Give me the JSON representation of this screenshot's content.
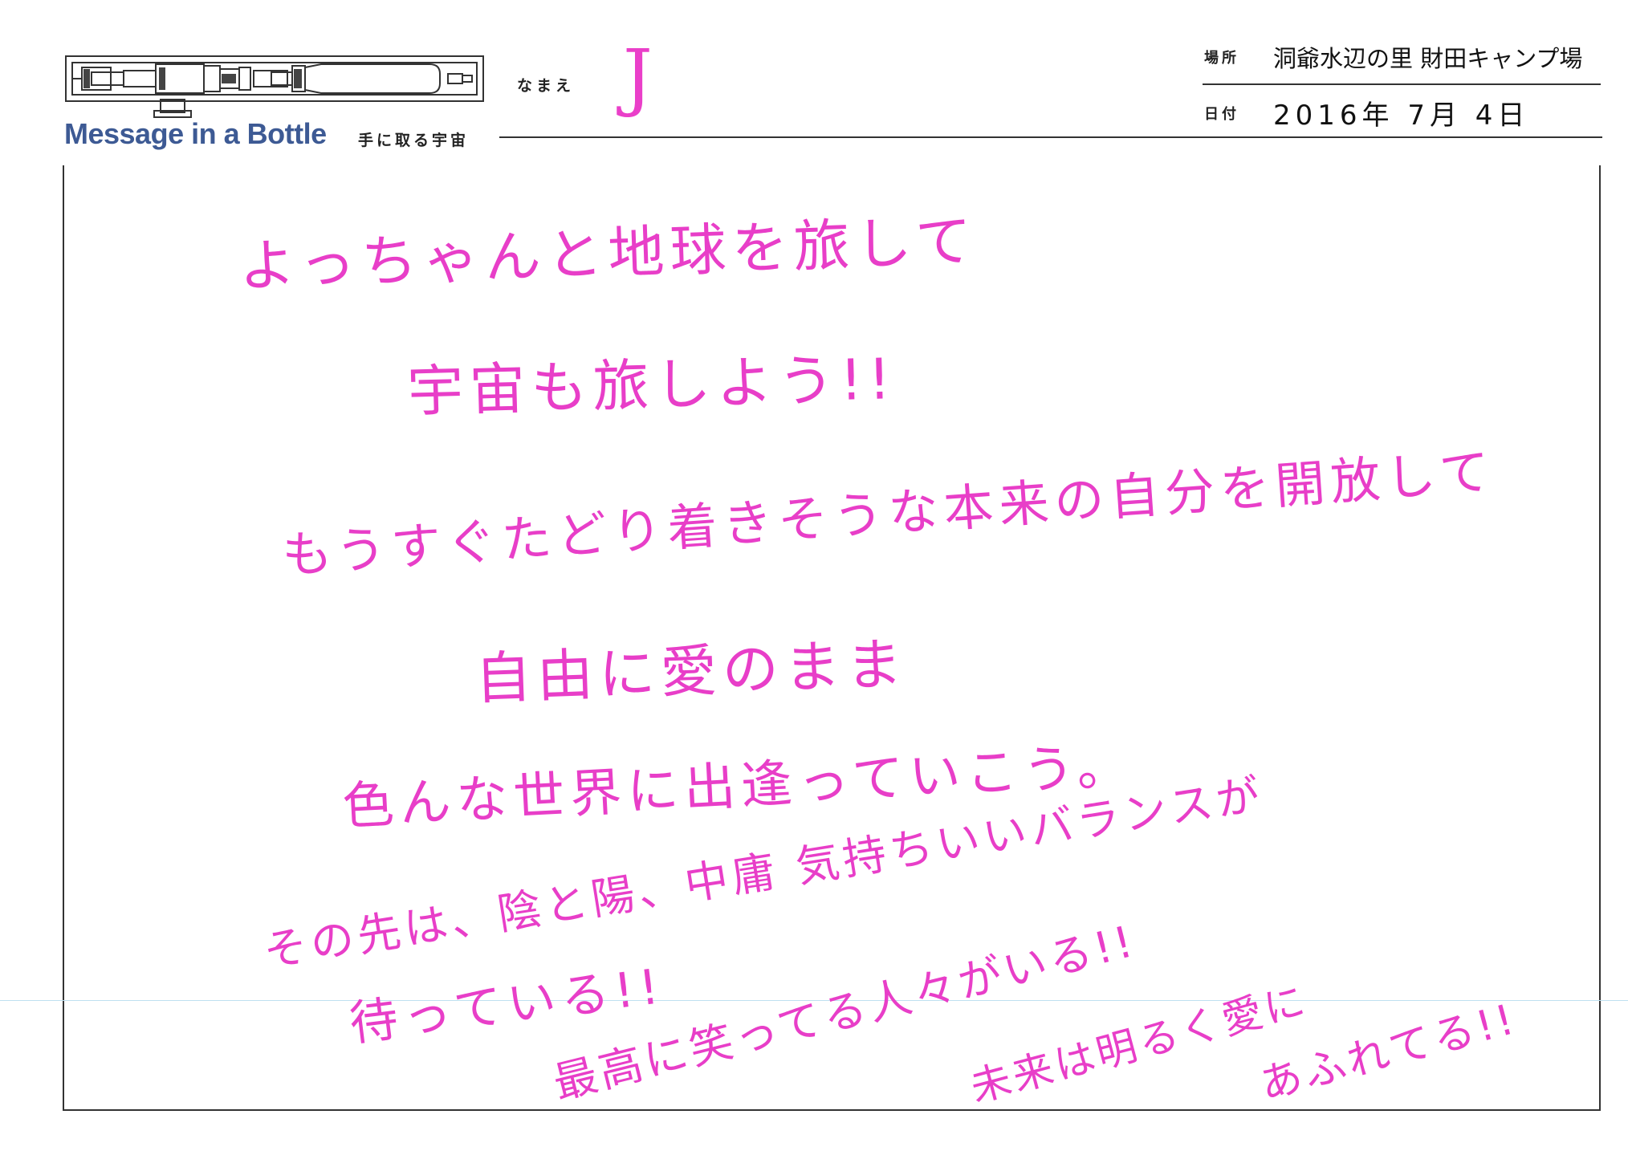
{
  "header": {
    "logo_text": "Message in a Bottle",
    "logo_subtitle": "手に取る宇宙",
    "name_label": "なまえ",
    "name_value": "J",
    "place_label": "場所",
    "place_value": "洞爺水辺の里 財田キャンプ場",
    "date_label": "日付",
    "date_value": "2016年 7月 4日"
  },
  "message": {
    "lines": [
      "よっちゃんと地球を旅して",
      "宇宙も旅しよう!!",
      "もうすぐたどり着きそうな本来の自分を開放して",
      "自由に愛のまま",
      "色んな世界に出逢っていこう。",
      "その先は、陰と陽、中庸 気持ちいいバランスが",
      "待っている!!",
      "最高に笑ってる人々がいる!!",
      "未来は明るく愛に",
      "あふれてる!!"
    ],
    "ink_color": "#e83ec8"
  }
}
